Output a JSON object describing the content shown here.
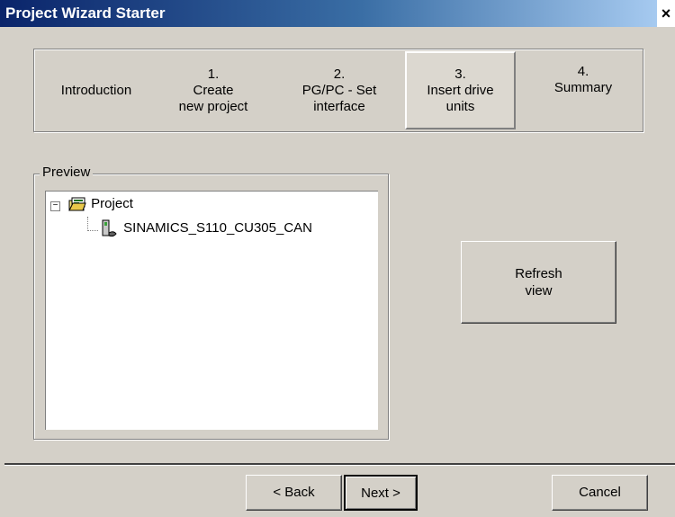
{
  "window": {
    "title": "Project Wizard Starter",
    "close_glyph": "×"
  },
  "steps": [
    {
      "number": "",
      "label": "Introduction"
    },
    {
      "number": "1.",
      "label": "Create\nnew project"
    },
    {
      "number": "2.",
      "label": "PG/PC - Set\ninterface"
    },
    {
      "number": "3.",
      "label": "Insert drive\nunits",
      "active": true
    },
    {
      "number": "4.",
      "label": "Summary"
    }
  ],
  "preview": {
    "label": "Preview",
    "tree": {
      "expander": "−",
      "root": "Project",
      "child": "SINAMICS_S110_CU305_CAN"
    }
  },
  "buttons": {
    "refresh": "Refresh\nview",
    "back": "< Back",
    "next": "Next >",
    "cancel": "Cancel"
  },
  "colors": {
    "dialog_bg": "#d4d0c8",
    "titlebar_start": "#0a246a",
    "titlebar_end": "#a6caf0"
  }
}
